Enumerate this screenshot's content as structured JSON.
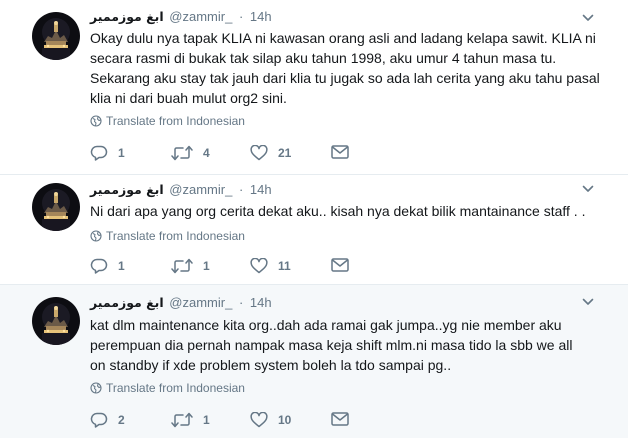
{
  "tweets": [
    {
      "name": "ابغ موزممير",
      "handle": "@zammir_",
      "separator": "·",
      "time": "14h",
      "text": "Okay dulu nya tapak KLIA ni kawasan orang asli and ladang kelapa sawit. KLIA ni secara rasmi di bukak tak silap aku tahun 1998, aku umur 4 tahun masa tu. Sekarang aku stay tak jauh dari klia tu jugak so ada lah cerita yang aku tahu pasal klia ni dari buah mulut org2 sini.",
      "translate": "Translate from Indonesian",
      "replies": "1",
      "retweets": "4",
      "likes": "21"
    },
    {
      "name": "ابغ موزممير",
      "handle": "@zammir_",
      "separator": "·",
      "time": "14h",
      "text": "Ni dari apa yang org cerita dekat aku.. kisah nya dekat bilik mantainance staff . .",
      "translate": "Translate from Indonesian",
      "replies": "1",
      "retweets": "1",
      "likes": "11"
    },
    {
      "name": "ابغ موزممير",
      "handle": "@zammir_",
      "separator": "·",
      "time": "14h",
      "text": "kat dlm maintenance kita org..dah ada ramai gak jumpa..yg nie member aku\nperempuan dia pernah nampak masa keja shift mlm.ni masa tido la sbb we all\non standby if xde problem system boleh la tdo sampai pg..",
      "translate": "Translate from Indonesian",
      "replies": "2",
      "retweets": "1",
      "likes": "10"
    }
  ],
  "colors": {
    "text_primary": "#14171a",
    "text_secondary": "#657786",
    "highlight_bg": "#f5f8fa",
    "divider": "#e6ecf0"
  },
  "icons": [
    "avatar-image",
    "chevron-down-icon",
    "globe-icon",
    "reply-icon",
    "retweet-icon",
    "heart-icon",
    "envelope-icon"
  ]
}
